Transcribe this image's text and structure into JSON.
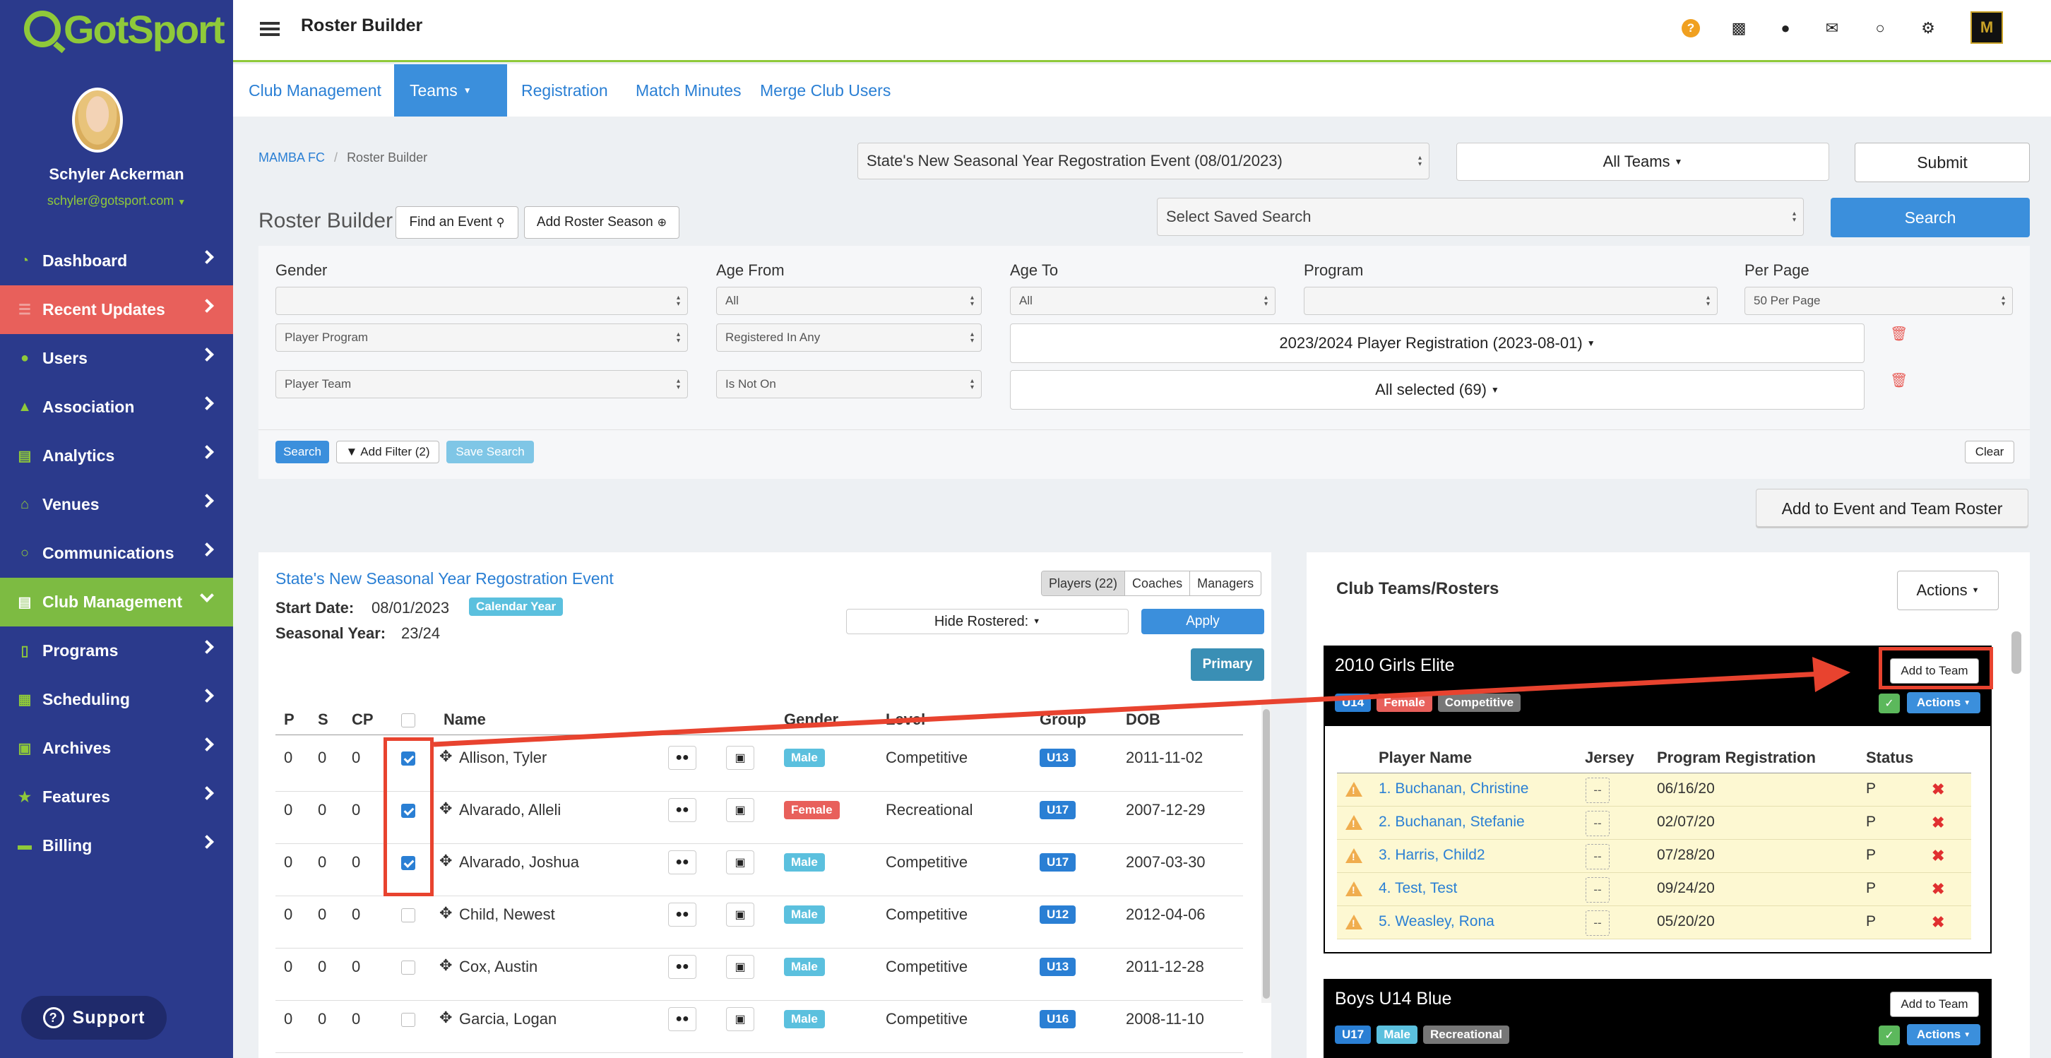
{
  "brand": {
    "logo_text": "GotSport"
  },
  "user": {
    "name": "Schyler Ackerman",
    "email": "schyler@gotsport.com"
  },
  "sidebar": {
    "items": [
      {
        "label": "Dashboard",
        "icon": "dashboard-icon"
      },
      {
        "label": "Recent Updates",
        "icon": "updates-icon",
        "status": "highlighted"
      },
      {
        "label": "Users",
        "icon": "users-icon"
      },
      {
        "label": "Association",
        "icon": "sitemap-icon"
      },
      {
        "label": "Analytics",
        "icon": "chart-icon"
      },
      {
        "label": "Venues",
        "icon": "home-icon"
      },
      {
        "label": "Communications",
        "icon": "comments-icon"
      },
      {
        "label": "Club Management",
        "icon": "club-icon",
        "status": "active"
      },
      {
        "label": "Programs",
        "icon": "book-icon"
      },
      {
        "label": "Scheduling",
        "icon": "calendar-icon"
      },
      {
        "label": "Archives",
        "icon": "archive-icon"
      },
      {
        "label": "Features",
        "icon": "star-icon"
      },
      {
        "label": "Billing",
        "icon": "credit-card-icon"
      }
    ],
    "support_label": "Support"
  },
  "topbar": {
    "title": "Roster Builder",
    "icons": [
      "help-icon",
      "qr-code-icon",
      "user-icon",
      "mail-icon",
      "chat-icon",
      "gear-icon",
      "club-logo-icon"
    ]
  },
  "tabs": [
    {
      "label": "Club Management"
    },
    {
      "label": "Teams",
      "active": true
    },
    {
      "label": "Registration"
    },
    {
      "label": "Match Minutes"
    },
    {
      "label": "Merge Club Users"
    }
  ],
  "breadcrumb": {
    "root": "MAMBA FC",
    "separator": "/",
    "current": "Roster Builder"
  },
  "header_controls": {
    "event_select": "State's New Seasonal Year Regostration Event (08/01/2023)",
    "teams_dropdown": "All Teams",
    "submit_label": "Submit",
    "saved_search_placeholder": "Select Saved Search",
    "search_label": "Search"
  },
  "roster_builder": {
    "title": "Roster Builder",
    "find_event_label": "Find an Event",
    "add_roster_season_label": "Add Roster Season"
  },
  "filters": {
    "labels": {
      "gender": "Gender",
      "age_from": "Age From",
      "age_to": "Age To",
      "program": "Program",
      "per_page": "Per Page"
    },
    "row1": {
      "gender": "",
      "age_from": "All",
      "age_to": "All",
      "program": "",
      "per_page": "50 Per Page"
    },
    "row2": {
      "field": "Player Program",
      "operator": "Registered In Any",
      "value": "2023/2024 Player Registration (2023-08-01)"
    },
    "row3": {
      "field": "Player Team",
      "operator": "Is Not On",
      "value": "All selected (69)"
    },
    "search_label": "Search",
    "add_filter_label": "Add Filter (2)",
    "save_search_label": "Save Search",
    "clear_label": "Clear"
  },
  "add_to_event_label": "Add to Event and Team Roster",
  "event_panel": {
    "event_name": "State's New Seasonal Year Regostration Event",
    "start_date_label": "Start Date:",
    "start_date": "08/01/2023",
    "calendar_badge": "Calendar Year",
    "seasonal_year_label": "Seasonal Year:",
    "seasonal_year": "23/24",
    "toggle": {
      "players": "Players (22)",
      "coaches": "Coaches",
      "managers": "Managers"
    },
    "hide_rostered": "Hide Rostered:",
    "apply_label": "Apply",
    "primary_label": "Primary",
    "columns": [
      "P",
      "S",
      "CP",
      "",
      "Name",
      "",
      "",
      "Gender",
      "Level",
      "Group",
      "DOB"
    ],
    "rows": [
      {
        "p": "0",
        "s": "0",
        "cp": "0",
        "checked": true,
        "name": "Allison, Tyler",
        "gender": "Male",
        "level": "Competitive",
        "group": "U13",
        "dob": "2011-11-02"
      },
      {
        "p": "0",
        "s": "0",
        "cp": "0",
        "checked": true,
        "name": "Alvarado, Alleli",
        "gender": "Female",
        "level": "Recreational",
        "group": "U17",
        "dob": "2007-12-29"
      },
      {
        "p": "0",
        "s": "0",
        "cp": "0",
        "checked": true,
        "name": "Alvarado, Joshua",
        "gender": "Male",
        "level": "Competitive",
        "group": "U17",
        "dob": "2007-03-30"
      },
      {
        "p": "0",
        "s": "0",
        "cp": "0",
        "checked": false,
        "name": "Child, Newest",
        "gender": "Male",
        "level": "Competitive",
        "group": "U12",
        "dob": "2012-04-06"
      },
      {
        "p": "0",
        "s": "0",
        "cp": "0",
        "checked": false,
        "name": "Cox, Austin",
        "gender": "Male",
        "level": "Competitive",
        "group": "U13",
        "dob": "2011-12-28"
      },
      {
        "p": "0",
        "s": "0",
        "cp": "0",
        "checked": false,
        "name": "Garcia, Logan",
        "gender": "Male",
        "level": "Competitive",
        "group": "U16",
        "dob": "2008-11-10"
      }
    ]
  },
  "teams_panel": {
    "title": "Club Teams/Rosters",
    "actions_label": "Actions",
    "teams": [
      {
        "name": "2010 Girls Elite",
        "add_label": "Add to Team",
        "badges": [
          "U14",
          "Female",
          "Competitive"
        ],
        "actions_label": "Actions",
        "columns": [
          "Player Name",
          "Jersey",
          "Program Registration",
          "Status"
        ],
        "players": [
          {
            "name": "1. Buchanan, Christine",
            "jersey": "--",
            "registration": "06/16/20",
            "status": "P"
          },
          {
            "name": "2. Buchanan, Stefanie",
            "jersey": "--",
            "registration": "02/07/20",
            "status": "P"
          },
          {
            "name": "3. Harris, Child2",
            "jersey": "--",
            "registration": "07/28/20",
            "status": "P"
          },
          {
            "name": "4. Test, Test",
            "jersey": "--",
            "registration": "09/24/20",
            "status": "P"
          },
          {
            "name": "5. Weasley, Rona",
            "jersey": "--",
            "registration": "05/20/20",
            "status": "P"
          }
        ]
      },
      {
        "name": "Boys U14 Blue",
        "add_label": "Add to Team",
        "badges": [
          "U17",
          "Male",
          "Recreational"
        ],
        "actions_label": "Actions"
      }
    ]
  },
  "colors": {
    "sidebar": "#2b3a8c",
    "accent_green": "#8fc93a",
    "primary_blue": "#2a7fd4",
    "annotation_red": "#e8432f"
  }
}
